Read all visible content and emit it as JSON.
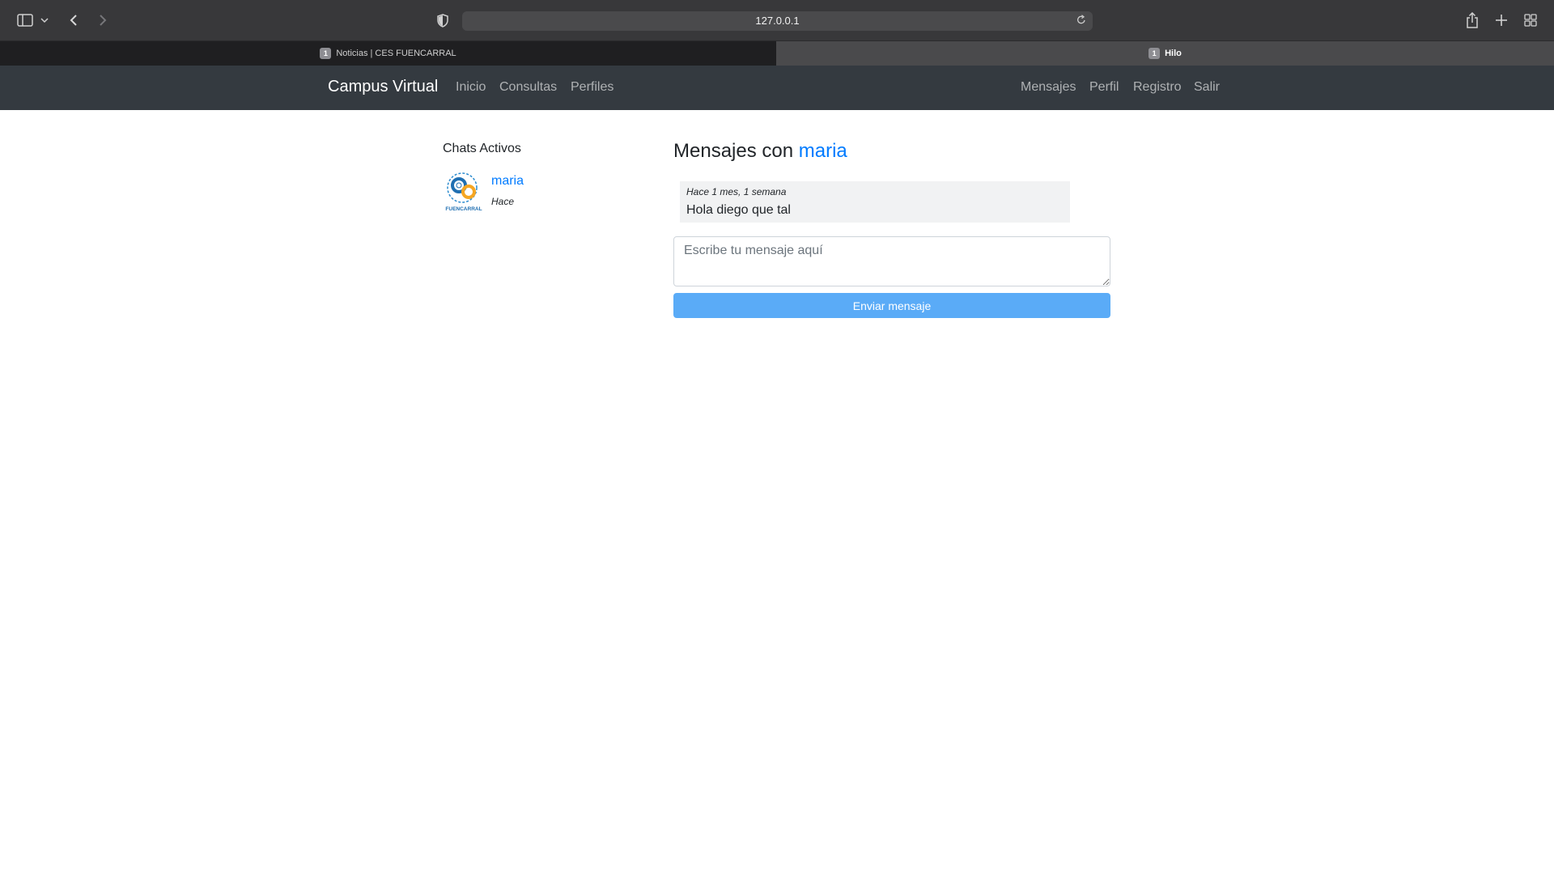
{
  "browser": {
    "url": "127.0.0.1",
    "tabs": [
      {
        "badge": "1",
        "label": "Noticias | CES FUENCARRAL",
        "active": false
      },
      {
        "badge": "1",
        "label": "Hilo",
        "active": true
      }
    ]
  },
  "navbar": {
    "brand": "Campus Virtual",
    "left_links": [
      "Inicio",
      "Consultas",
      "Perfiles"
    ],
    "right_links": [
      "Mensajes",
      "Perfil",
      "Registro",
      "Salir"
    ]
  },
  "sidebar": {
    "title": "Chats Activos",
    "chats": [
      {
        "name": "maria",
        "time": "Hace",
        "avatar_text": "FUENCARRAL"
      }
    ]
  },
  "conversation": {
    "title_prefix": "Mensajes con",
    "title_user": "maria",
    "messages": [
      {
        "time": "Hace 1 mes, 1 semana",
        "text": "Hola diego que tal"
      }
    ],
    "input_placeholder": "Escribe tu mensaje aquí",
    "send_label": "Enviar mensaje"
  },
  "colors": {
    "link": "#007bff",
    "navbar_bg": "#343a40",
    "send_button": "#5aabf7"
  }
}
